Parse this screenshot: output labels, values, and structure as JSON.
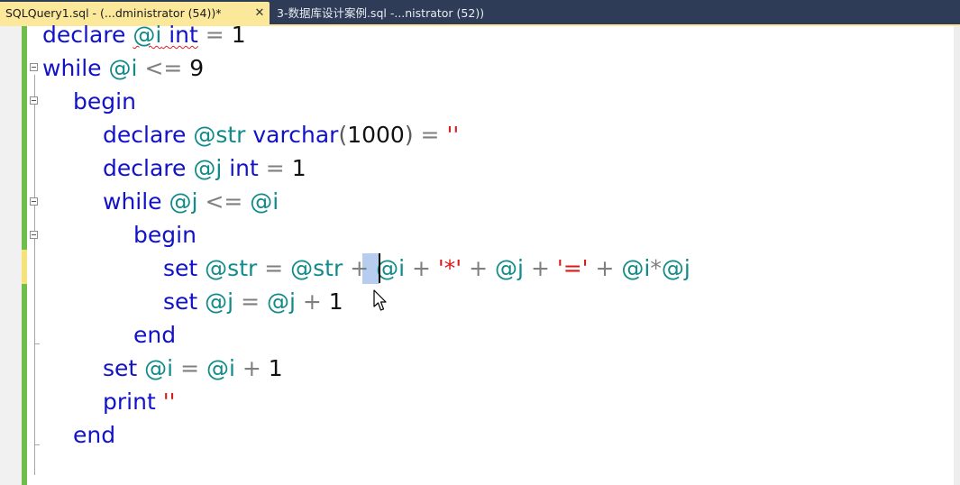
{
  "tabs": [
    {
      "label": "SQLQuery1.sql - (...dministrator (54))*",
      "close_symbol": "✕",
      "active": true
    },
    {
      "label": "3-数据库设计案例.sql -...nistrator (52))",
      "active": false
    }
  ],
  "code": {
    "line1": {
      "declare": "declare",
      "var": "@i",
      "type": "int",
      "op": "=",
      "num": "1"
    },
    "line2": {
      "while": "while",
      "var": "@i",
      "op": "<=",
      "num": "9"
    },
    "line3": {
      "begin": "begin"
    },
    "line4": {
      "declare": "declare",
      "var": "@str",
      "type": "varchar",
      "paren_open": "(",
      "num": "1000",
      "paren_close": ")",
      "op": "=",
      "str": "''"
    },
    "line5": {
      "declare": "declare",
      "var": "@j",
      "type": "int",
      "op": "=",
      "num": "1"
    },
    "line6": {
      "while": "while",
      "var": "@j",
      "op": "<=",
      "var2": "@i"
    },
    "line7": {
      "begin": "begin"
    },
    "line8": {
      "set": "set",
      "var": "@str",
      "op": "=",
      "var2": "@str",
      "plus": "+",
      "var3": "@i",
      "plus2": "+",
      "str1": "'*'",
      "plus3": "+",
      "var4": "@j",
      "plus4": "+",
      "str2": "'='",
      "plus5": "+",
      "var5": "@i",
      "star": "*",
      "var6": "@j"
    },
    "line9": {
      "set": "set",
      "var": "@j",
      "op": "=",
      "var2": "@j",
      "plus": "+",
      "num": "1"
    },
    "line10": {
      "end": "end"
    },
    "line11": {
      "set": "set",
      "var": "@i",
      "op": "=",
      "var2": "@i",
      "plus": "+",
      "num": "1"
    },
    "line12": {
      "print": "print",
      "str": "''"
    },
    "line13": {
      "end": "end"
    }
  },
  "colors": {
    "keyword": "#1212c8",
    "variable": "#118a8a",
    "string": "#dd1818",
    "operator": "#7f7f7f",
    "active_tab": "#fbe89a",
    "tab_bar": "#2e3c57",
    "change_bar": "#6fbd4d"
  },
  "icons": {
    "tab_close": "close-icon",
    "fold": "fold-collapse-icon",
    "mouse": "arrow-cursor-icon"
  }
}
